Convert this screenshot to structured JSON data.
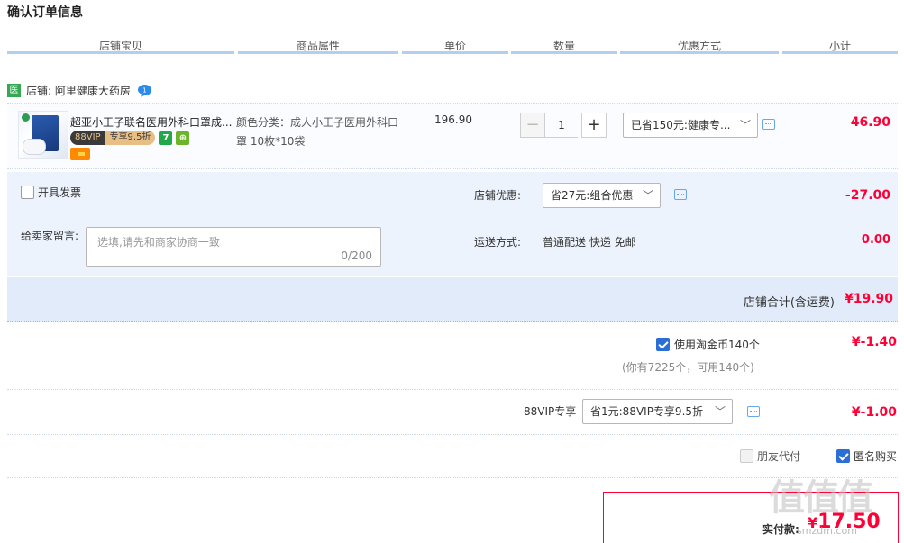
{
  "page": {
    "title": "确认订单信息"
  },
  "columns": [
    "店铺宝贝",
    "商品属性",
    "单价",
    "数量",
    "优惠方式",
    "小计"
  ],
  "shop": {
    "icon_text": "医",
    "label": "店铺: 阿里健康大药房",
    "chat_icon": "chat-bubble-icon"
  },
  "item": {
    "title": "超亚小王子联名医用外科口罩成...",
    "vip_badge_left": "88VIP",
    "vip_badge_right": "专享9.5折",
    "badge1": "7",
    "badge2": "⊕",
    "attr_line1": "颜色分类：成人小王子医用外科口",
    "attr_line2": "罩 10枚*10袋",
    "price": "196.90",
    "qty_minus": "−",
    "qty": "1",
    "qty_plus": "+",
    "promo_select": "已省150元:健康专...",
    "subtotal": "46.90"
  },
  "extra": {
    "invoice_label": "开具发票",
    "memo_label": "给卖家留言:",
    "memo_placeholder": "选填,请先和商家协商一致",
    "memo_count": "0/200",
    "shop_discount_label": "店铺优惠:",
    "shop_discount_select": "省27元:组合优惠",
    "shop_discount_amount": "-27.00",
    "shipping_label": "运送方式:",
    "shipping_value": "普通配送 快递 免邮",
    "shipping_amount": "0.00"
  },
  "shop_total": {
    "label": "店铺合计(含运费)",
    "value": "¥19.90"
  },
  "coins": {
    "label": "使用淘金币140个",
    "sub": "(你有7225个，可用140个)",
    "amount": "¥-1.40",
    "checked": true
  },
  "vip": {
    "label": "88VIP专享",
    "select": "省1元:88VIP专享9.5折",
    "amount": "¥-1.00"
  },
  "options": {
    "friend_pay": "朋友代付",
    "anonymous": "匿名购买",
    "anonymous_checked": true
  },
  "pay": {
    "label": "实付款:",
    "currency": "¥",
    "value": "17.50"
  },
  "watermark": {
    "main": "值值值",
    "sub": "smzdm.com"
  },
  "colors": {
    "accent": "#ff0036",
    "header_line": "#b3cfee",
    "panel_bg": "#edf3fc",
    "checkbox": "#2a6ed6"
  }
}
